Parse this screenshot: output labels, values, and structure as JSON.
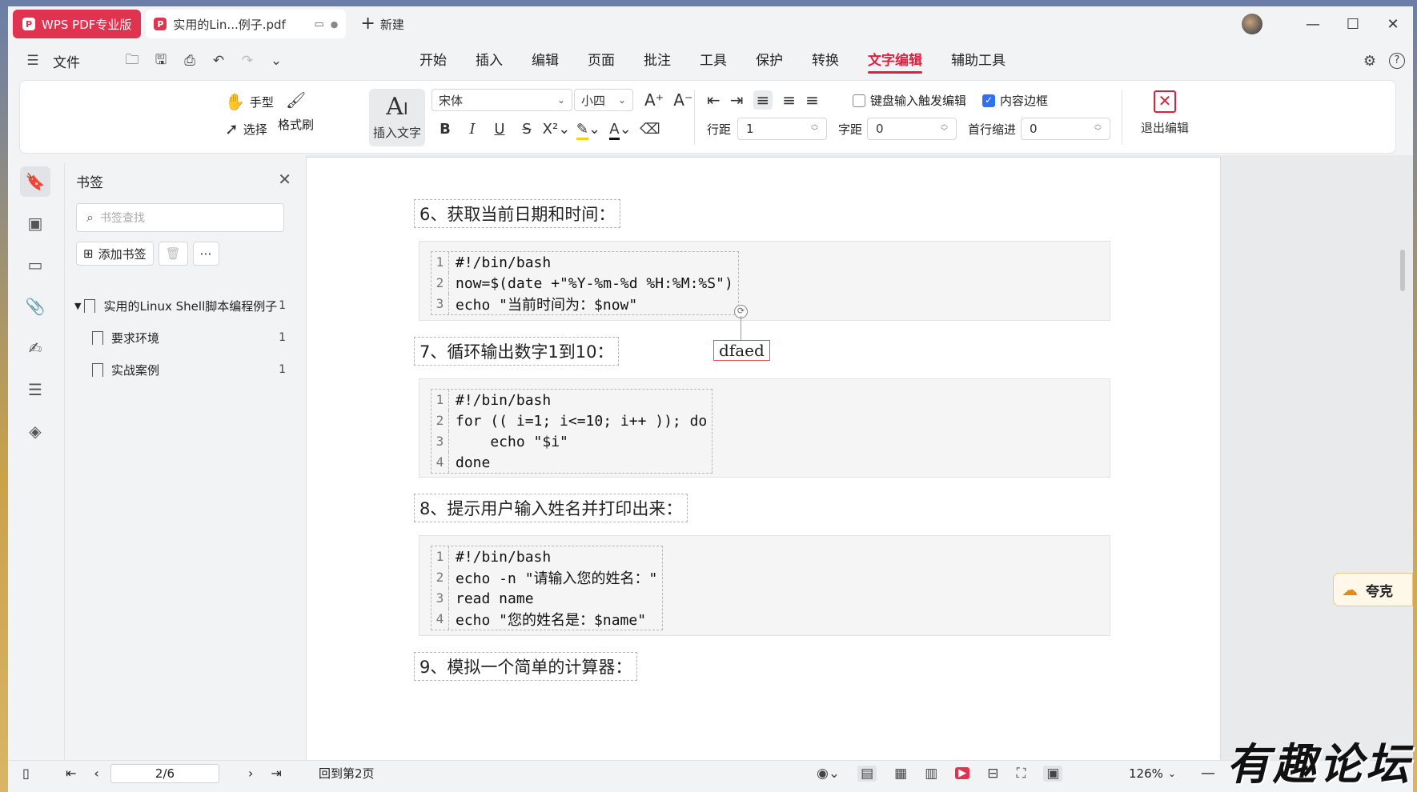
{
  "titlebar": {
    "app_tab": "WPS PDF专业版",
    "doc_tab": "实用的Lin...例子.pdf",
    "new_tab": "新建"
  },
  "menubar": {
    "file": "文件",
    "tabs": [
      "开始",
      "插入",
      "编辑",
      "页面",
      "批注",
      "工具",
      "保护",
      "转换",
      "文字编辑",
      "辅助工具"
    ],
    "active_tab": "文字编辑"
  },
  "toolbar": {
    "hand": "手型",
    "select": "选择",
    "format_painter": "格式刷",
    "insert_text": "插入文字",
    "font_name": "宋体",
    "font_size": "小四",
    "keyboard_edit_label": "键盘输入触发编辑",
    "content_border_label": "内容边框",
    "line_spacing_label": "行距",
    "line_spacing_value": "1",
    "char_spacing_label": "字距",
    "char_spacing_value": "0",
    "indent_label": "首行缩进",
    "indent_value": "0",
    "exit_edit": "退出编辑"
  },
  "bookmarks": {
    "title": "书签",
    "search_placeholder": "书签查找",
    "add_button": "添加书签",
    "items": [
      {
        "label": "实用的Linux Shell脚本编程例子",
        "page": "1"
      },
      {
        "label": "要求环境",
        "page": "1"
      },
      {
        "label": "实战案例",
        "page": "1"
      }
    ]
  },
  "document": {
    "sections": [
      {
        "heading": "6、获取当前日期和时间：",
        "lines": [
          "#!/bin/bash",
          "now=$(date +\"%Y-%m-%d %H:%M:%S\")",
          "echo \"当前时间为：$now\""
        ]
      },
      {
        "heading": "7、循环输出数字1到10：",
        "lines": [
          "#!/bin/bash",
          "for (( i=1; i<=10; i++ )); do",
          "    echo \"$i\"",
          "done"
        ]
      },
      {
        "heading": "8、提示用户输入姓名并打印出来：",
        "lines": [
          "#!/bin/bash",
          "echo -n \"请输入您的姓名：\"",
          "read name",
          "echo \"您的姓名是：$name\""
        ]
      },
      {
        "heading": "9、模拟一个简单的计算器：",
        "lines": []
      }
    ],
    "floating_text": "dfaed",
    "line_numbers": [
      "1",
      "2",
      "3",
      "4"
    ]
  },
  "side_widget": {
    "label": "夸克"
  },
  "statusbar": {
    "page_indicator": "2/6",
    "back_to_page": "回到第2页",
    "zoom": "126%"
  },
  "watermark": "有趣论坛"
}
